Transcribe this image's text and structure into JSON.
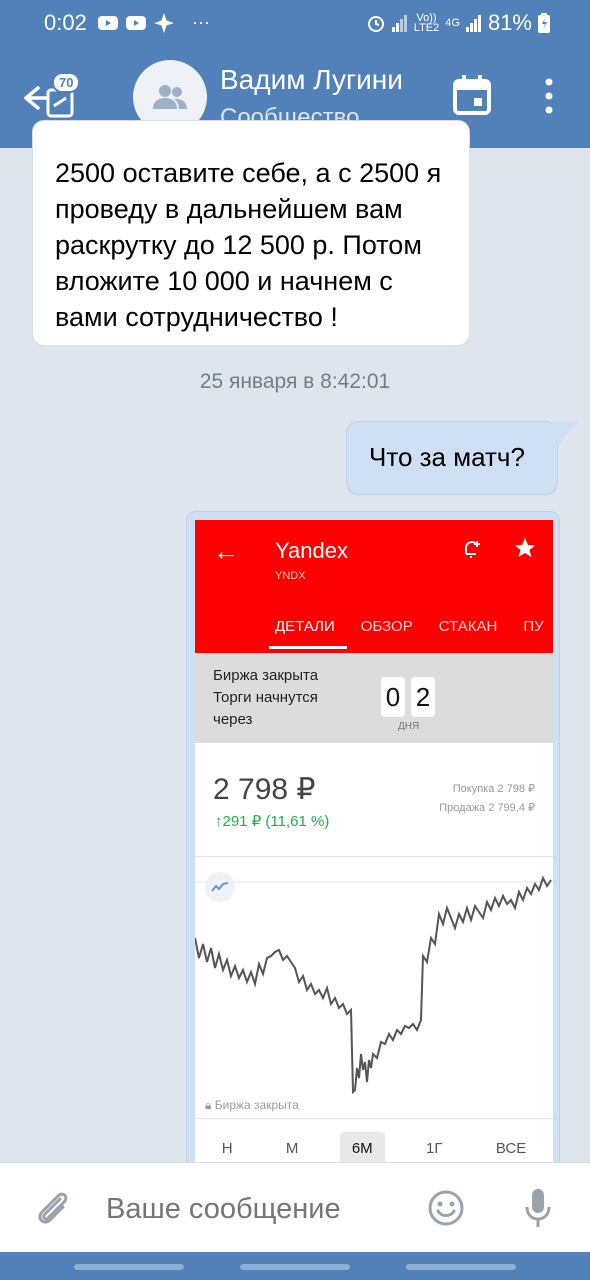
{
  "status_bar": {
    "time": "0:02",
    "battery": "81%",
    "volte": "Vo))",
    "lte": "LTE2",
    "net": "4G",
    "more": "···"
  },
  "header": {
    "back_badge": "70",
    "title": "Вадим Лугини",
    "subtitle": "Сообщество"
  },
  "messages": {
    "incoming_text": "2500 оставите себе, а с 2500 я проведу в дальнейшем вам раскрутку до 12 500 р. Потом вложите 10 000 и начнем с вами сотрудничество !",
    "date_separator": "25 января в 8:42:01",
    "outgoing_text": "Что за матч?"
  },
  "attachment": {
    "title": "Yandex",
    "ticker": "YNDX",
    "tabs": [
      "ДЕТАЛИ",
      "ОБЗОР",
      "СТАКАН",
      "ПУ"
    ],
    "closed_text": "Биржа закрыта Торги начнутся через",
    "digits": [
      "0",
      "2"
    ],
    "days_label": "ДНЯ",
    "price": "2 798 ₽",
    "change": "↑291 ₽ (11,61 %)",
    "bid": "Покупка 2 798 ₽",
    "ask": "Продажа 2 799,4 ₽",
    "chart_footer": "Биржа закрыта",
    "periods": [
      "Н",
      "М",
      "6М",
      "1Г",
      "ВСЕ"
    ],
    "active_period": "6М",
    "red": "#ff0000",
    "green": "#1fae47"
  },
  "composer": {
    "placeholder": "Ваше сообщение"
  },
  "colors": {
    "accent": "#5181b8",
    "chat_bg": "#dfe5ec",
    "outgoing_bubble": "#cfe0f5"
  }
}
